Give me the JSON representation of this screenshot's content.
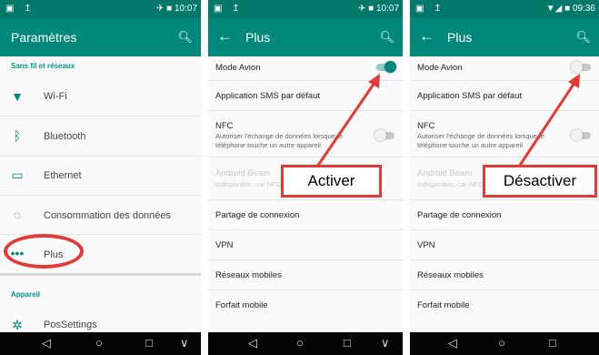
{
  "panel1": {
    "status_left": "▣ ↥",
    "status_right": "✈ ■ 10:07",
    "title": "Paramètres",
    "section_wireless": "Sans fil et réseaux",
    "items": [
      {
        "label": "Wi-Fi",
        "icon": "wifi-icon"
      },
      {
        "label": "Bluetooth",
        "icon": "bluetooth-icon"
      },
      {
        "label": "Ethernet",
        "icon": "ethernet-icon"
      },
      {
        "label": "Consommation des données",
        "icon": "data-usage-icon"
      },
      {
        "label": "Plus",
        "icon": "more-icon"
      }
    ],
    "section_device": "Appareil",
    "device_item": "PosSettings"
  },
  "panel2": {
    "status_left": "▣ ↥",
    "status_right": "✈ ■ 10:07",
    "title": "Plus",
    "airplane_mode": "Mode Avion",
    "sms_app": "Application SMS par défaut",
    "nfc": "NFC",
    "nfc_desc": "Autoriser l'échange de données lorsque le téléphone touche un autre appareil",
    "android_beam": "Android Beam",
    "android_beam_desc": "Indisponible, car NFC est désactivé",
    "tethering": "Partage de connexion",
    "vpn": "VPN",
    "mobile_networks": "Réseaux mobiles",
    "mobile_plan": "Forfait mobile",
    "callout": "Activer",
    "airplane_toggle": "on"
  },
  "panel3": {
    "status_left": "▣ ↥",
    "status_right": "▼◢ ■ 09:36",
    "title": "Plus",
    "airplane_mode": "Mode Avion",
    "sms_app": "Application SMS par défaut",
    "nfc": "NFC",
    "nfc_desc": "Autoriser l'échange de données lorsque le téléphone touche un autre appareil",
    "android_beam": "Android Beam",
    "android_beam_desc": "Indisponible, car NFC est désactivé",
    "tethering": "Partage de connexion",
    "vpn": "VPN",
    "mobile_networks": "Réseaux mobiles",
    "mobile_plan": "Forfait mobile",
    "callout": "Désactiver",
    "airplane_toggle": "off"
  },
  "navbar": {
    "back": "◁",
    "home": "○",
    "recents": "□",
    "down": "∨"
  },
  "colors": {
    "accent": "#00897b",
    "status": "#00796b",
    "annotation": "#e53935"
  }
}
